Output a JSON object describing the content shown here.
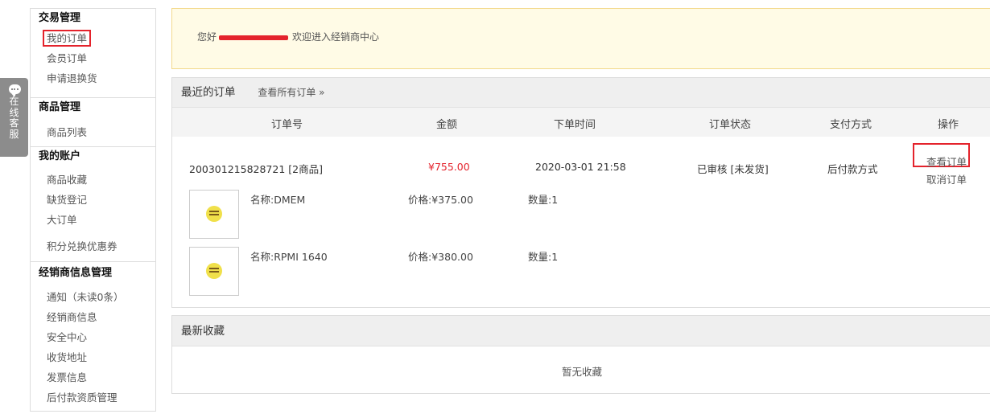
{
  "service_tab": {
    "label": "在线客服"
  },
  "sidebar": {
    "sections": [
      {
        "title": "交易管理",
        "items": [
          "我的订单",
          "会员订单",
          "申请退换货"
        ]
      },
      {
        "title": "商品管理",
        "items": [
          "商品列表"
        ]
      },
      {
        "title": "我的账户",
        "items": [
          "商品收藏",
          "缺货登记",
          "大订单",
          "积分兑换优惠券"
        ]
      },
      {
        "title": "经销商信息管理",
        "items": [
          "通知（未读0条）",
          "经销商信息",
          "安全中心",
          "收货地址",
          "发票信息",
          "后付款资质管理"
        ]
      }
    ]
  },
  "welcome": {
    "greeting": "您好",
    "suffix": "欢迎进入经销商中心"
  },
  "orders_panel": {
    "title": "最近的订单",
    "view_all": "查看所有订单 »",
    "columns": [
      "订单号",
      "金额",
      "下单时间",
      "订单状态",
      "支付方式",
      "操作"
    ],
    "order": {
      "number": "200301215828721 [2商品]",
      "amount": "¥755.00",
      "time": "2020-03-01 21:58",
      "status": "已审核 [未发货]",
      "payment": "后付款方式",
      "view_action": "查看订单",
      "cancel_action": "取消订单"
    },
    "items": [
      {
        "name": "名称:DMEM",
        "price": "价格:¥375.00",
        "qty": "数量:1"
      },
      {
        "name": "名称:RPMI 1640",
        "price": "价格:¥380.00",
        "qty": "数量:1"
      }
    ]
  },
  "favorites_panel": {
    "title": "最新收藏",
    "empty": "暂无收藏"
  },
  "colors": {
    "accent_red": "#e4232c",
    "banner_bg": "#fffbe6",
    "panel_head_bg": "#efefef"
  }
}
